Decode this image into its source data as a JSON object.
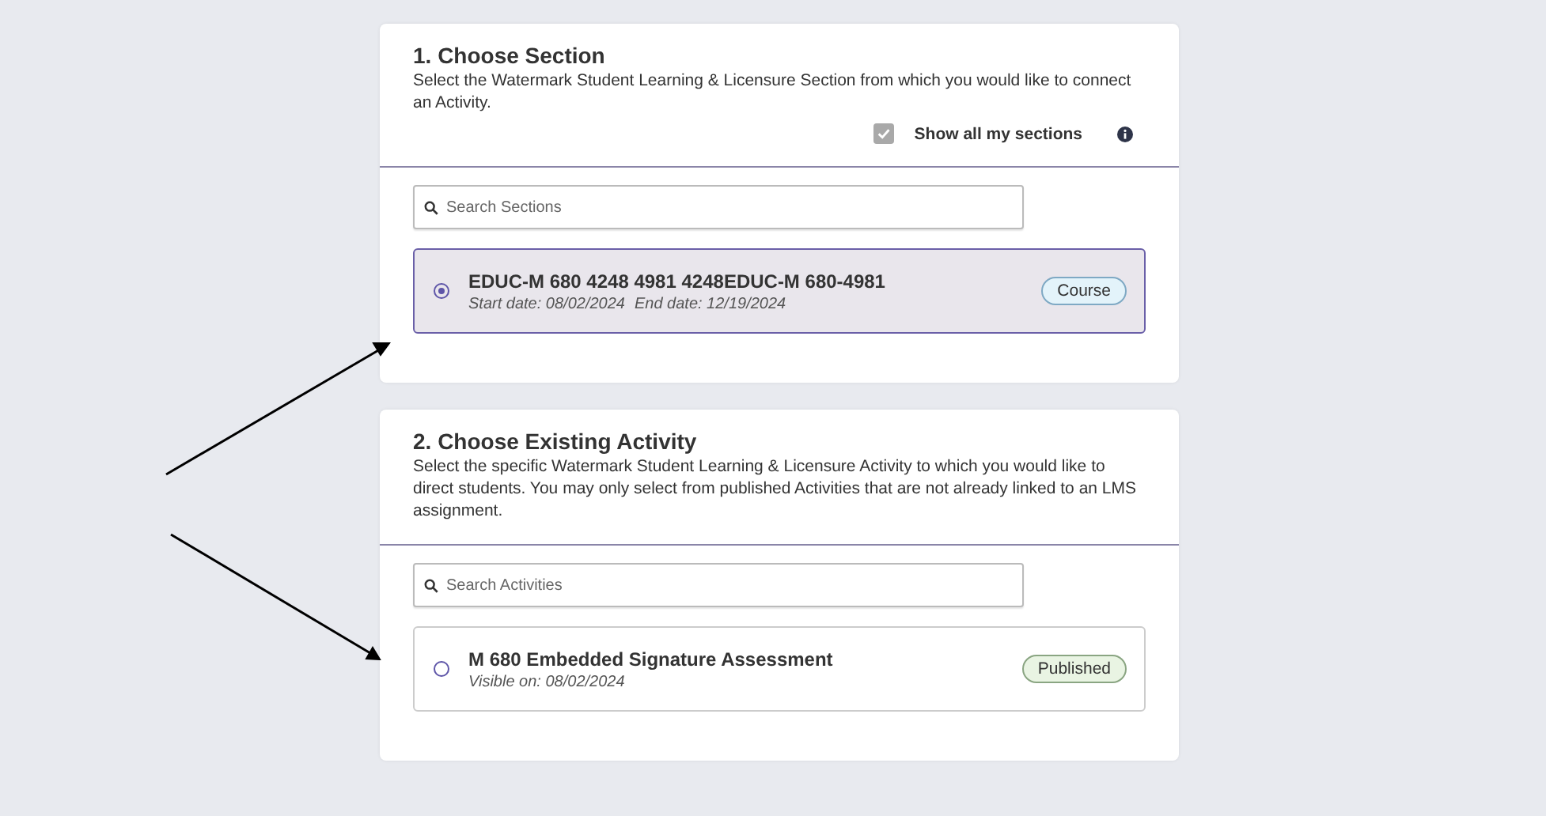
{
  "sections": [
    {
      "title": "1. Choose Section",
      "description": "Select the Watermark Student Learning & Licensure Section from which you would like to connect an Activity.",
      "show_all": {
        "label": "Show all my sections",
        "checked": true
      },
      "search": {
        "placeholder": "Search Sections"
      },
      "items": [
        {
          "title": "EDUC-M 680 4248 4981 4248EDUC-M 680-4981",
          "details": [
            "Start date: 08/02/2024",
            "End date: 12/19/2024"
          ],
          "badge": {
            "label": "Course",
            "kind": "course"
          },
          "selected": true
        }
      ]
    },
    {
      "title": "2. Choose Existing Activity",
      "description": "Select the specific Watermark Student Learning & Licensure Activity to which you would like to direct students. You may only select from published Activities that are not already linked to an LMS assignment.",
      "search": {
        "placeholder": "Search Activities"
      },
      "items": [
        {
          "title": "M 680 Embedded Signature Assessment",
          "details": [
            "Visible on: 08/02/2024"
          ],
          "badge": {
            "label": "Published",
            "kind": "published"
          },
          "selected": false
        }
      ]
    }
  ]
}
